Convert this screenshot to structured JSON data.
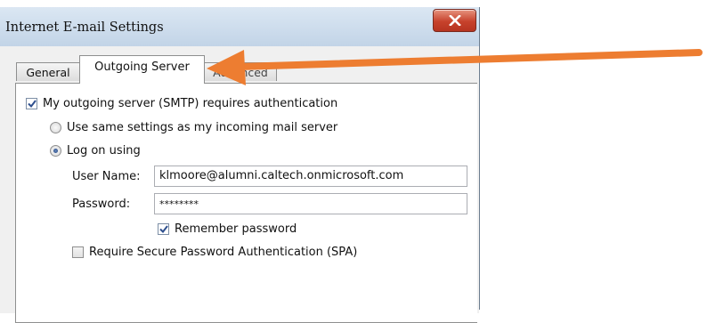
{
  "dialog": {
    "title": "Internet E-mail Settings",
    "close_icon": "close-icon"
  },
  "tabs": [
    {
      "label": "General",
      "active": false
    },
    {
      "label": "Outgoing Server",
      "active": true
    },
    {
      "label": "Advanced",
      "active": false
    }
  ],
  "outgoing": {
    "smtp_auth": {
      "label": "My outgoing server (SMTP) requires authentication",
      "checked": true
    },
    "same_settings": {
      "label": "Use same settings as my incoming mail server",
      "selected": false
    },
    "log_on_using": {
      "label": "Log on using",
      "selected": true
    },
    "user_name": {
      "label": "User Name:",
      "value": "klmoore@alumni.caltech.onmicrosoft.com"
    },
    "password": {
      "label": "Password:",
      "value": "********"
    },
    "remember_password": {
      "label": "Remember password",
      "checked": true
    },
    "spa": {
      "label": "Require Secure Password Authentication (SPA)",
      "checked": false
    }
  },
  "annotation": {
    "arrow_color": "#ed7d31",
    "icon": "arrow-left-icon"
  },
  "colors": {
    "close_button": "#c7422c",
    "titlebar": "#c4d5e6",
    "accent": "#1f3f7a"
  }
}
